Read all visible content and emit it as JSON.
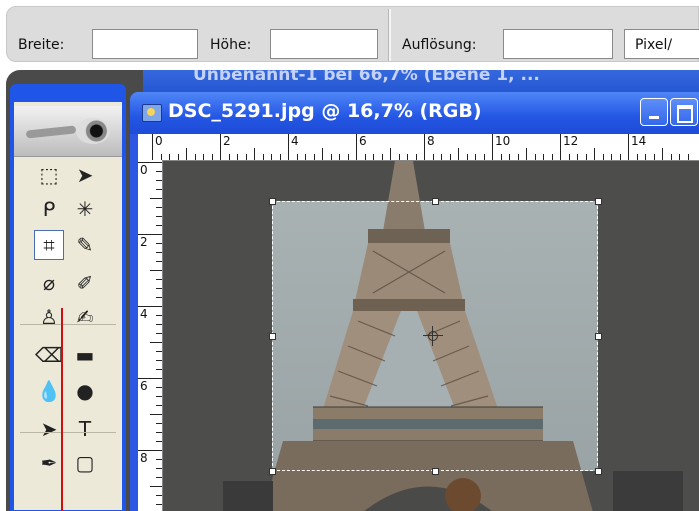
{
  "options_bar": {
    "width_label": "Breite:",
    "width_value": "",
    "height_label": "Höhe:",
    "height_value": "",
    "resolution_label": "Auflösung:",
    "resolution_value": "",
    "unit_value": "Pixel/"
  },
  "background_window": {
    "title": "Unbenannt-1 bei 66,7% (Ebene 1, ..."
  },
  "document_window": {
    "title": "DSC_5291.jpg @ 16,7% (RGB)"
  },
  "ruler_top": [
    "0",
    "2",
    "4",
    "6",
    "8",
    "10",
    "12",
    "14"
  ],
  "ruler_left": [
    "0",
    "2",
    "4",
    "6",
    "8"
  ],
  "toolbox": {
    "tools": [
      {
        "name": "marquee-tool-icon",
        "glyph": "⬚"
      },
      {
        "name": "move-tool-icon",
        "glyph": "➤"
      },
      {
        "name": "lasso-tool-icon",
        "glyph": "ᑭ"
      },
      {
        "name": "magic-wand-tool-icon",
        "glyph": "✳"
      },
      {
        "name": "crop-tool-icon",
        "glyph": "⌗"
      },
      {
        "name": "slice-tool-icon",
        "glyph": "✎"
      },
      {
        "name": "healing-brush-tool-icon",
        "glyph": "⌀"
      },
      {
        "name": "brush-tool-icon",
        "glyph": "✐"
      },
      {
        "name": "clone-stamp-tool-icon",
        "glyph": "♙"
      },
      {
        "name": "history-brush-tool-icon",
        "glyph": "✍"
      },
      {
        "name": "eraser-tool-icon",
        "glyph": "⌫"
      },
      {
        "name": "gradient-tool-icon",
        "glyph": "▬"
      },
      {
        "name": "blur-tool-icon",
        "glyph": "💧"
      },
      {
        "name": "dodge-tool-icon",
        "glyph": "●"
      },
      {
        "name": "path-selection-tool-icon",
        "glyph": "➤"
      },
      {
        "name": "type-tool-icon",
        "glyph": "T"
      },
      {
        "name": "pen-tool-icon",
        "glyph": "✒"
      },
      {
        "name": "shape-tool-icon",
        "glyph": "▢"
      }
    ]
  }
}
